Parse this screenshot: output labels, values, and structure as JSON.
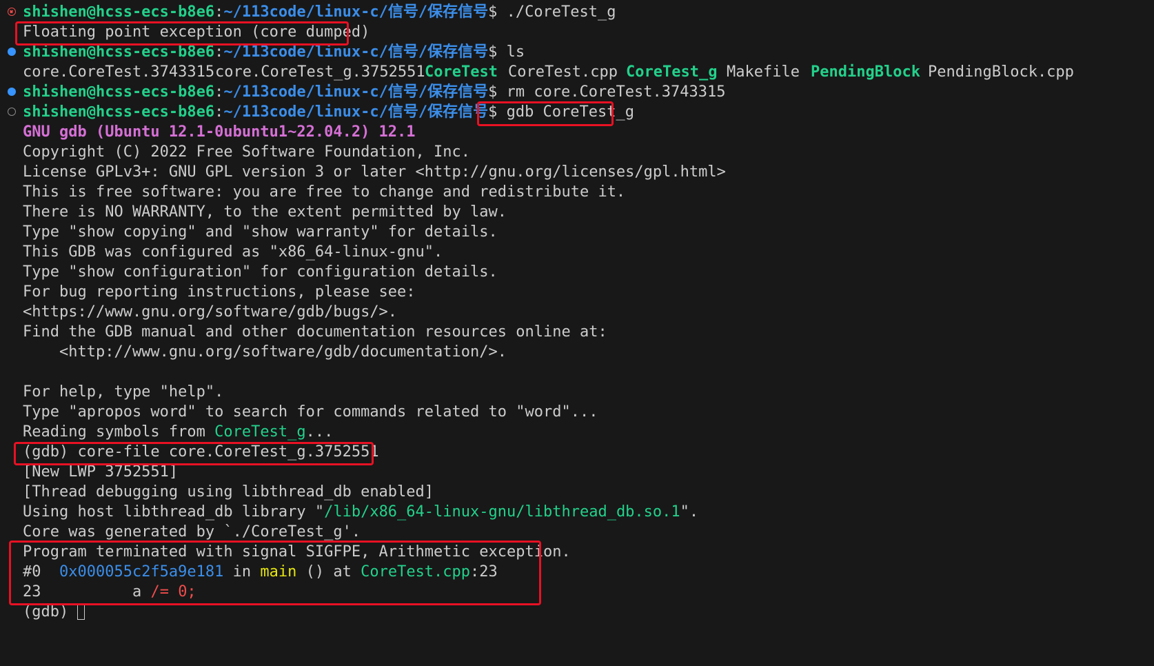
{
  "colors": {
    "background": "#181818",
    "foreground": "#cccccc",
    "prompt_user": "#23d18b",
    "prompt_path": "#3b8eea",
    "executable": "#23d18b",
    "gdb_banner": "#d670d6",
    "address": "#3b8eea",
    "function": "#e5e510",
    "operator": "#f14c4c",
    "highlight_box": "#e81123"
  },
  "prompt": {
    "user_host": "shishen@hcss-ecs-b8e6",
    "colon": ":",
    "path": "~/113code/linux-c/信号/保存信号",
    "dollar": "$ "
  },
  "icons": {
    "failed": "circle-x-icon",
    "succeeded": "filled-circle-icon",
    "running": "hollow-circle-icon"
  },
  "commands": {
    "run": "./CoreTest_g",
    "list": "ls",
    "remove": "rm core.CoreTest.3743315",
    "debug": "gdb CoreTest_g"
  },
  "output": {
    "fpe": "Floating point exception (core dumped)",
    "ls_items": [
      {
        "name": "core.CoreTest.3743315",
        "executable": false
      },
      {
        "name": "core.CoreTest_g.3752551",
        "executable": false
      },
      {
        "name": "CoreTest",
        "executable": true
      },
      {
        "name": "CoreTest.cpp",
        "executable": false
      },
      {
        "name": "CoreTest_g",
        "executable": true
      },
      {
        "name": "Makefile",
        "executable": false
      },
      {
        "name": "PendingBlock",
        "executable": true
      },
      {
        "name": "PendingBlock.cpp",
        "executable": false
      }
    ]
  },
  "gdb": {
    "banner": "GNU gdb (Ubuntu 12.1-0ubuntu1~22.04.2) 12.1",
    "intro": [
      "Copyright (C) 2022 Free Software Foundation, Inc.",
      "License GPLv3+: GNU GPL version 3 or later <http://gnu.org/licenses/gpl.html>",
      "This is free software: you are free to change and redistribute it.",
      "There is NO WARRANTY, to the extent permitted by law.",
      "Type \"show copying\" and \"show warranty\" for details.",
      "This GDB was configured as \"x86_64-linux-gnu\".",
      "Type \"show configuration\" for configuration details.",
      "For bug reporting instructions, please see:",
      "<https://www.gnu.org/software/gdb/bugs/>.",
      "Find the GDB manual and other documentation resources online at:",
      "    <http://www.gnu.org/software/gdb/documentation/>.",
      "",
      "For help, type \"help\".",
      "Type \"apropos word\" to search for commands related to \"word\"..."
    ],
    "reading_prefix": "Reading symbols from ",
    "reading_file": "CoreTest_g",
    "reading_suffix": "...",
    "corefile_cmd": "(gdb) core-file core.CoreTest_g.3752551",
    "new_lwp": "[New LWP 3752551]",
    "thread_debug": "[Thread debugging using libthread_db enabled]",
    "host_lib_prefix": "Using host libthread_db library \"",
    "host_lib_path": "/lib/x86_64-linux-gnu/libthread_db.so.1",
    "host_lib_suffix": "\".",
    "core_generated": "Core was generated by `./CoreTest_g'.",
    "terminated": "Program terminated with signal SIGFPE, Arithmetic exception.",
    "frame_num": "#0  ",
    "frame_addr": "0x000055c2f5a9e181",
    "frame_in": " in ",
    "frame_func": "main",
    "frame_args": " () at ",
    "frame_file": "CoreTest.cpp",
    "frame_line": ":23",
    "src_lineno": "23",
    "src_gap": "\t    ",
    "src_var": "a ",
    "src_op": "/= 0;",
    "final_prompt": "(gdb) "
  }
}
